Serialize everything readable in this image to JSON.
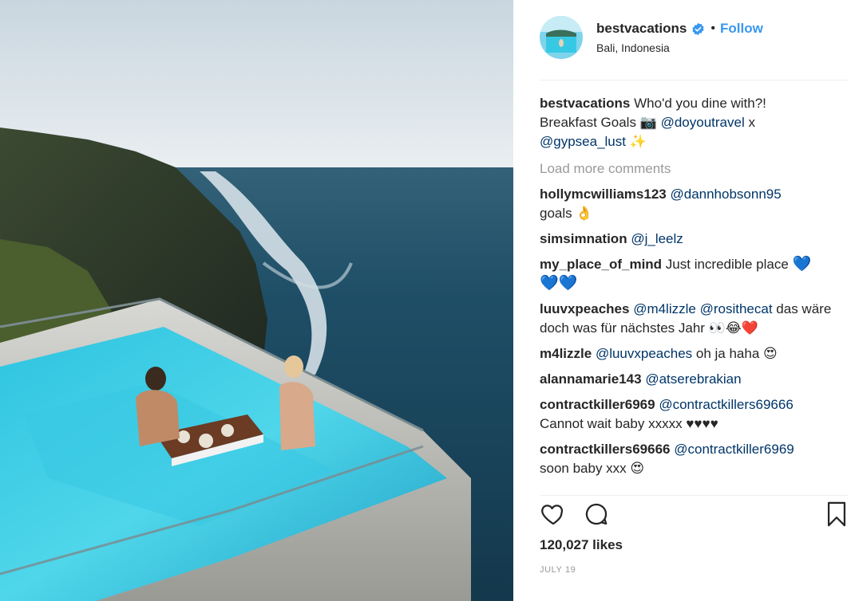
{
  "post": {
    "username": "bestvacations",
    "follow_label": "Follow",
    "dot": "•",
    "location": "Bali, Indonesia",
    "caption": {
      "user": "bestvacations",
      "text_1": "Who'd you dine with?!",
      "text_2": "Breakfast Goals",
      "camera_emoji": "📷",
      "mention_1": "@doyoutravel",
      "x": "x",
      "mention_2": "@gypsea_lust",
      "sparkle_emoji": "✨"
    },
    "load_more": "Load more comments",
    "comments": [
      {
        "user": "hollymcwilliams123",
        "mention": "@dannhobsonn95",
        "text": "goals",
        "emoji": "👌"
      },
      {
        "user": "simsimnation",
        "mention": "@j_leelz"
      },
      {
        "user": "my_place_of_mind",
        "text": "Just incredible place",
        "emoji": "💙",
        "text2": "💙💙"
      },
      {
        "user": "luuvxpeaches",
        "mention": "@m4lizzle",
        "mention2": "@rosithecat",
        "text": "das wäre doch was für nächstes Jahr",
        "emoji": "👀😂❤️"
      },
      {
        "user": "m4lizzle",
        "mention": "@luuvxpeaches",
        "text": "oh ja haha",
        "emoji": "😍"
      },
      {
        "user": "alannamarie143",
        "mention": "@atserebrakian"
      },
      {
        "user": "contractkiller6969",
        "mention": "@contractkillers69666",
        "text": "Cannot wait baby xxxxx ♥♥♥♥"
      },
      {
        "user": "contractkillers69666",
        "mention": "@contractkiller6969",
        "text": "soon baby xxx",
        "emoji": "😍"
      }
    ],
    "likes": "120,027 likes",
    "date": "JULY 19",
    "icons": {
      "like": "heart-outline-icon",
      "comment": "speech-bubble-icon",
      "save": "bookmark-icon",
      "verified": "verified-badge-icon"
    },
    "colors": {
      "link": "#003569",
      "follow": "#3897f0",
      "muted": "#999999",
      "verified": "#3897f0"
    }
  }
}
